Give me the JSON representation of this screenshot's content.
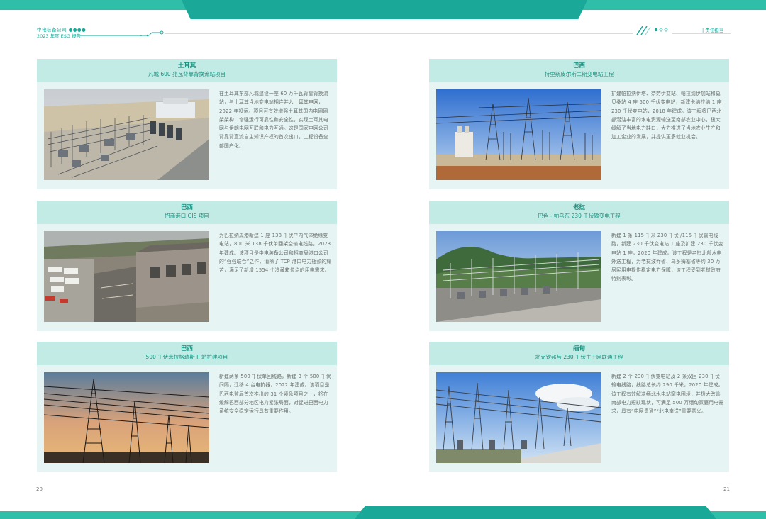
{
  "header": {
    "company": "中电装备公司 ●●●●",
    "report": "2023 年度 ESG 报告",
    "section": "| 责任担当 |"
  },
  "colors": {
    "accent": "#1aa898",
    "band": "#2fbfa9",
    "card_bg": "#e6f5f3",
    "card_head": "#c3ebe5"
  },
  "cards": [
    {
      "country": "土耳其",
      "project": "凡城 600 兆瓦背靠背换流站项目",
      "text": "在土耳其东部凡城建设一座 60 万千瓦背靠背换流站，与土耳其当地变电站相连并入土耳其电网，2022 年投运。项目可有效增强土耳其国内电网网架架构，增强运行可靠性和安全性，实现土耳其电网与伊朗电网互联和电力互通。这是国家电网公司背靠背直流自主知识产权的首次出口，工程设备全部国产化。"
    },
    {
      "country": "巴西",
      "project": "特里斯皮尔斯二期变电站工程",
      "text": "扩建帕拉纳伊塔、奈劳伊变站、帕拉纳伊加站和莫贝桑站 4 座 500 千伏变电站，新建卡纳拉纳 1 座 230 千伏变电站，2018 年建成。该工程将巴西北部潜油丰富的水电资源输送至南部农业中心，极大缓解了当地电力缺口，大力推进了当地农业生产和加工企业的发展，并提供更多就业机会。"
    },
    {
      "country": "巴西",
      "project": "招商港口 GIS 项目",
      "text": "为巴拉纳瓜港新建 1 座 138 千伏户内气体绝缘变电站，800 米 138 千伏单回架空输电线路，2023 年建成。该项目是中电装备公司和招商局港口公司的“强强联合”之作，消除了 TCP 港口电力瓶颈的痛苦，满足了新增 1554 个冷藏箱位点的用电需求。"
    },
    {
      "country": "老挝",
      "project": "巴色 - 帕乌东 230 千伏输变电工程",
      "text": "新建 1 条 115 千米 230 千伏 /115 千伏输电线路，新建 230 千伏变电站 1 座及扩建 230 千伏变电站 1 座，2020 年建成。该工程是老挝北部水电外送工程，为老挝波乔省、乌多姆塞省等约 30 万居民用电提供稳定电力保障，该工程受到老挝政府特别表彰。"
    },
    {
      "country": "巴西",
      "project": "500 千伏米拉格瑞斯 II 站扩建项目",
      "text": "新建两条 500 千伏单回线路，新建 3 个 500 千伏间隔，迁移 4 台电抗器，2022 年建成。该项目是巴西电监局首次推出的 31 个紧急项目之一，将在缓解巴西部分地区电力紧张局面，对促进巴西电力系统安全稳定运行具有重要作用。"
    },
    {
      "country": "缅甸",
      "project": "北克钦邦与 230 千伏主干网联通工程",
      "text": "新建 2 个 230 千伏变电站及 2 条双回 230 千伏输电线路，线路总长约 290 千米，2020 年建成。该工程有效解决缅北水电站窝电困境，并极大改善南部电力短缺现状，可满足 500 万缅甸家庭用电需求，具有“电网贯通”“北电南送”重要意义。"
    }
  ],
  "page_numbers": {
    "left": "20",
    "right": "21"
  }
}
